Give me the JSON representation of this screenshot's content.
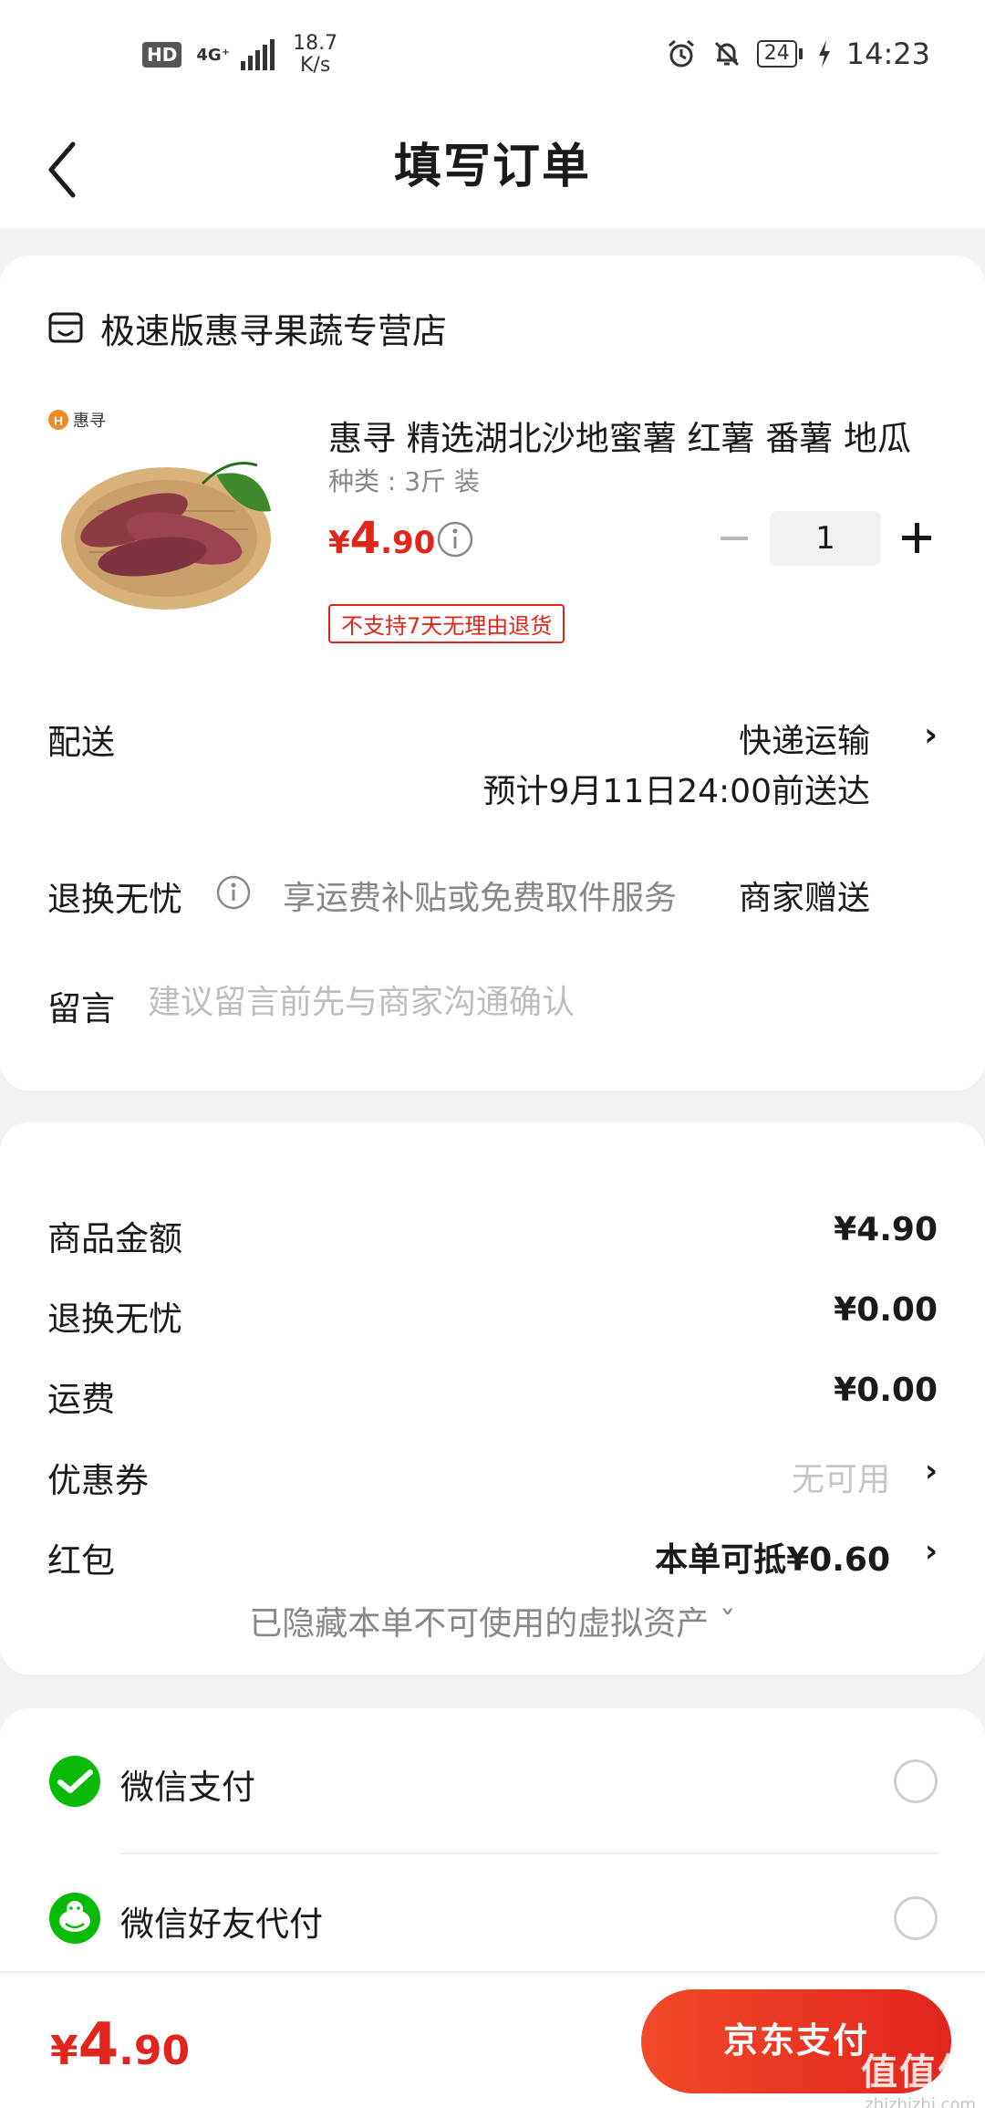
{
  "status_bar": {
    "hd": "HD",
    "network": "4G⁺",
    "speed_value": "18.7",
    "speed_unit": "K/s",
    "battery": "24",
    "time": "14:23"
  },
  "header": {
    "title": "填写订单",
    "back_icon": "chevron-left-icon"
  },
  "store": {
    "icon": "store-icon",
    "name": "极速版惠寻果蔬专营店"
  },
  "product": {
    "brand_logo": "惠寻",
    "title": "惠寻 精选湖北沙地蜜薯 红薯 番薯 地瓜",
    "spec": "种类 : 3斤 装",
    "price_yen": "¥",
    "price_int": "4",
    "price_dec": ".90",
    "quantity": "1",
    "return_tag": "不支持7天无理由退货"
  },
  "delivery": {
    "label": "配送",
    "method": "快递运输",
    "eta": "预计9月11日24:00前送达"
  },
  "return_worry": {
    "label": "退换无忧",
    "description": "享运费补贴或免费取件服务",
    "gift": "商家赠送"
  },
  "message": {
    "label": "留言",
    "placeholder": "建议留言前先与商家沟通确认",
    "value": ""
  },
  "summary": {
    "goods_label": "商品金额",
    "goods_value": "¥4.90",
    "worry_label": "退换无忧",
    "worry_value": "¥0.00",
    "freight_label": "运费",
    "freight_value": "¥0.00",
    "coupon_label": "优惠券",
    "coupon_value": "无可用",
    "redpacket_label": "红包",
    "redpacket_value": "本单可抵¥0.60",
    "hidden_assets": "已隐藏本单不可使用的虚拟资产 ˇ"
  },
  "payment": {
    "methods": [
      {
        "label": "微信支付",
        "icon": "wechat-pay-icon",
        "selected": false
      },
      {
        "label": "微信好友代付",
        "icon": "wechat-friend-pay-icon",
        "selected": false
      }
    ]
  },
  "footer": {
    "total_yen": "¥",
    "total_int": "4",
    "total_dec": ".90",
    "pay_button": "京东支付",
    "watermark_logo": "值值值",
    "watermark_url": "zhizhizhi.com"
  },
  "colors": {
    "accent": "#e1251b",
    "wechat_green": "#09bb07",
    "background": "#f2f2f2"
  }
}
